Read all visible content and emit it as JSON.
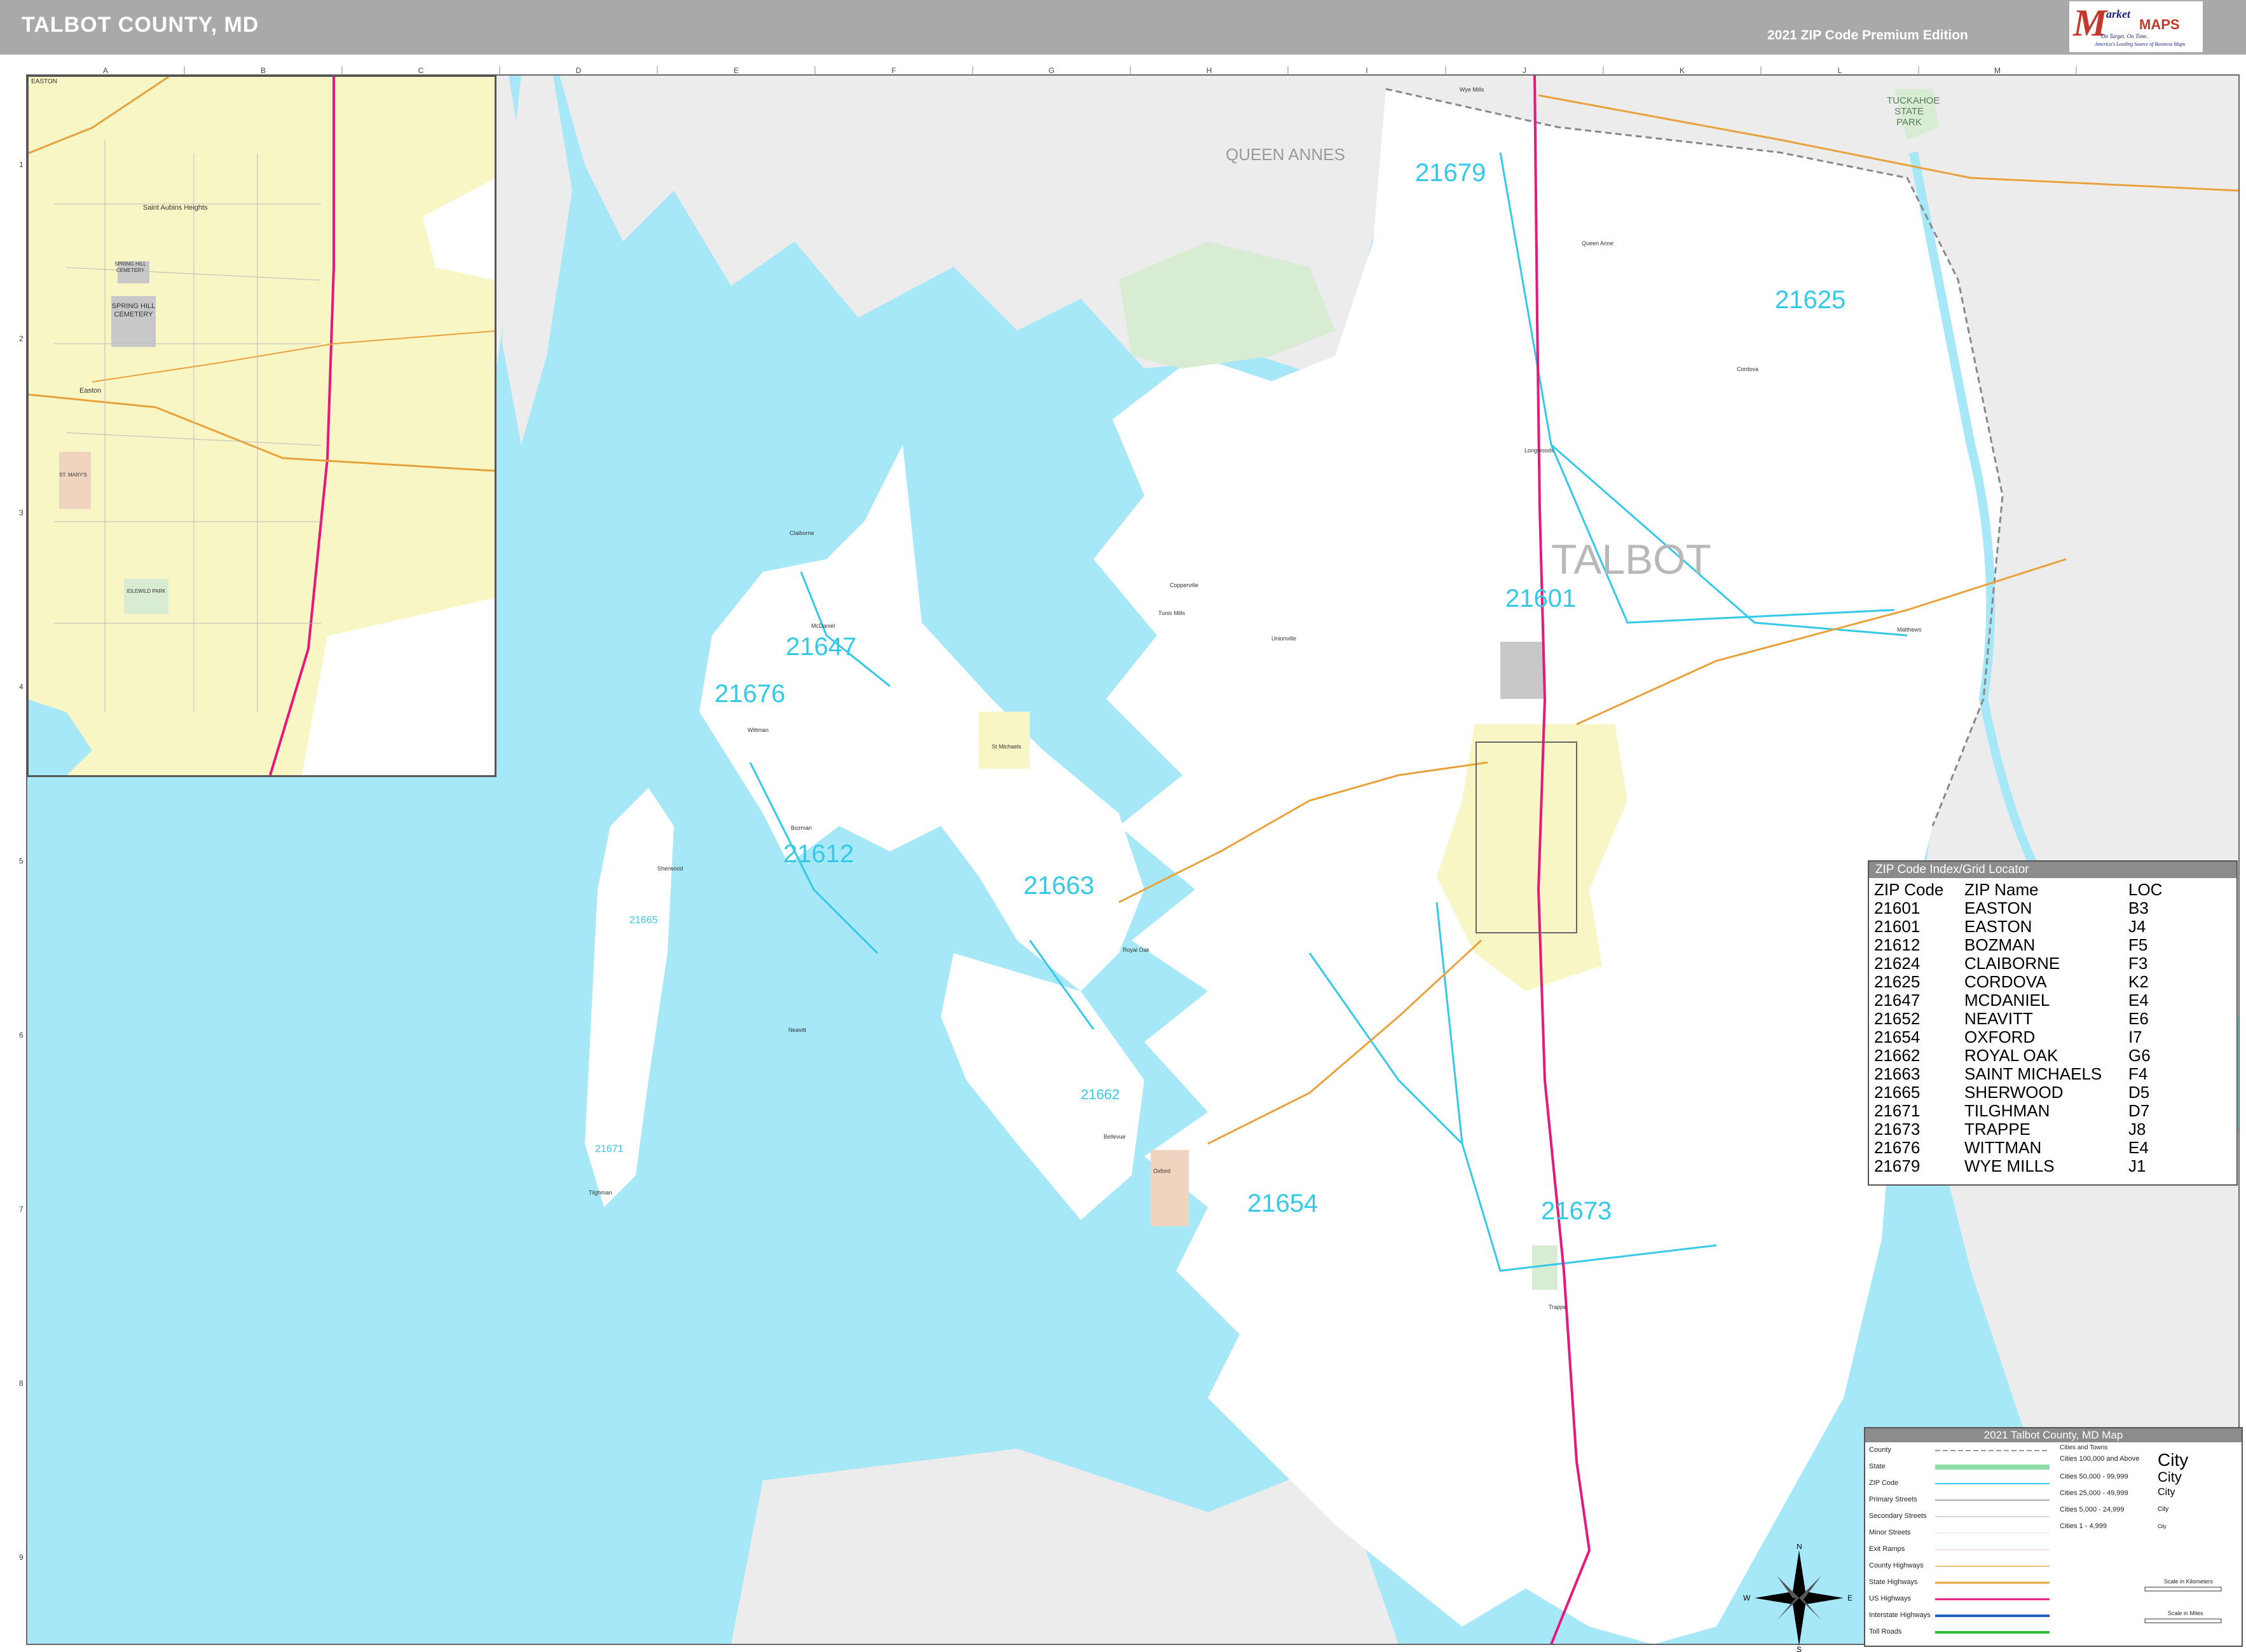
{
  "header": {
    "title": "TALBOT COUNTY, MD",
    "edition": "2021 ZIP Code Premium Edition"
  },
  "logo": {
    "m": "M",
    "word": "arket",
    "maps": "MAPS",
    "tagline": "On Target. On Time.",
    "tagline2": "America's Leading Source of Business Maps"
  },
  "grid": {
    "letters": [
      "A",
      "B",
      "C",
      "D",
      "E",
      "F",
      "G",
      "H",
      "I",
      "J",
      "K",
      "L",
      "M"
    ],
    "numbers": [
      "1",
      "2",
      "3",
      "4",
      "5",
      "6",
      "7",
      "8",
      "9"
    ]
  },
  "labels": {
    "county": "TALBOT",
    "neighbor": "QUEEN ANNES",
    "park": "TUCKAHOE STATE PARK",
    "inset_title": "EASTON",
    "inset_cemetery": "SPRING HILL CEMETERY",
    "inset_cemetery2": "SPRING HILL CEMETERY",
    "inset_park": "IDLEWILD PARK",
    "inset_school": "ST. MARY'S",
    "inset_place": "Saint Aubins Heights",
    "inset_easton": "Easton"
  },
  "zip_labels": {
    "z21679": "21679",
    "z21625": "21625",
    "z21601": "21601",
    "z21647": "21647",
    "z21676": "21676",
    "z21612": "21612",
    "z21663": "21663",
    "z21662": "21662",
    "z21654": "21654",
    "z21673": "21673",
    "z21665": "21665",
    "z21671": "21671"
  },
  "towns": {
    "wye_mills": "Wye Mills",
    "cordova": "Cordova",
    "queen_anne": "Queen Anne",
    "longwoods": "Longwoods",
    "claiborne": "Claiborne",
    "mcdaniel": "McDaniel",
    "wittman": "Wittman",
    "st_michaels": "St Michaels",
    "bozman": "Bozman",
    "sherwood": "Sherwood",
    "tilghman": "Tilghman",
    "royal_oak": "Royal Oak",
    "bellevue": "Bellevue",
    "oxford": "Oxford",
    "trappe": "Trappe",
    "easton": "Easton",
    "matthews": "Matthews",
    "neavitt": "Neavitt",
    "unionville": "Unionville",
    "copperville": "Copperville",
    "tunis_mills": "Tunis Mills"
  },
  "zip_index": {
    "title": "ZIP Code Index/Grid Locator",
    "headers": [
      "ZIP Code",
      "ZIP Name",
      "LOC"
    ],
    "rows": [
      [
        "21601",
        "EASTON",
        "B3"
      ],
      [
        "21601",
        "EASTON",
        "J4"
      ],
      [
        "21612",
        "BOZMAN",
        "F5"
      ],
      [
        "21624",
        "CLAIBORNE",
        "F3"
      ],
      [
        "21625",
        "CORDOVA",
        "K2"
      ],
      [
        "21647",
        "MCDANIEL",
        "E4"
      ],
      [
        "21652",
        "NEAVITT",
        "E6"
      ],
      [
        "21654",
        "OXFORD",
        "I7"
      ],
      [
        "21662",
        "ROYAL OAK",
        "G6"
      ],
      [
        "21663",
        "SAINT MICHAELS",
        "F4"
      ],
      [
        "21665",
        "SHERWOOD",
        "D5"
      ],
      [
        "21671",
        "TILGHMAN",
        "D7"
      ],
      [
        "21673",
        "TRAPPE",
        "J8"
      ],
      [
        "21676",
        "WITTMAN",
        "E4"
      ],
      [
        "21679",
        "WYE MILLS",
        "J1"
      ]
    ]
  },
  "legend": {
    "title": "2021 Talbot County, MD Map",
    "items": [
      "County",
      "State",
      "ZIP Code",
      "Primary Streets",
      "Secondary Streets",
      "Minor Streets",
      "Exit Ramps",
      "County Highways",
      "State Highways",
      "US Highways",
      "Interstate Highways",
      "Toll Roads"
    ],
    "cities_header": "Cities and Towns",
    "cities": [
      {
        "label": "Cities 100,000 and Above",
        "sample": "City"
      },
      {
        "label": "Cities 50,000 - 99,999",
        "sample": "City"
      },
      {
        "label": "Cities 25,000 - 49,999",
        "sample": "City"
      },
      {
        "label": "Cities 5,000 - 24,999",
        "sample": "City"
      },
      {
        "label": "Cities 1 - 4,999",
        "sample": "City"
      }
    ],
    "scale_km": "Scale in Kilometers",
    "scale_mi": "Scale in Miles",
    "compass": {
      "n": "N",
      "s": "S",
      "e": "E",
      "w": "W"
    }
  },
  "colors": {
    "water": "#a6e8f8",
    "land": "#ffffff",
    "outside_land": "#ececec",
    "urban": "#f9f6c5",
    "park": "#d7ecd3",
    "zip_line": "#35c9e8",
    "us_highway": "#e8177d",
    "state_highway": "#e8a23c"
  }
}
